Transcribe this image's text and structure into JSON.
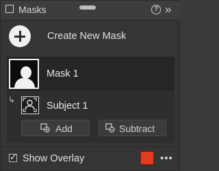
{
  "header": {
    "title": "Masks",
    "help_symbol": "?",
    "expand_symbol": "»"
  },
  "create": {
    "label": "Create New Mask"
  },
  "mask": {
    "label": "Mask 1",
    "subtype_label": "Subject 1",
    "connector_symbol": "↳"
  },
  "actions": {
    "add_label": "Add",
    "subtract_label": "Subtract"
  },
  "footer": {
    "overlay_label": "Show Overlay",
    "overlay_checked": true,
    "check_symbol": "✓",
    "overlay_color": "#e53a22",
    "more_symbol": "•••"
  }
}
